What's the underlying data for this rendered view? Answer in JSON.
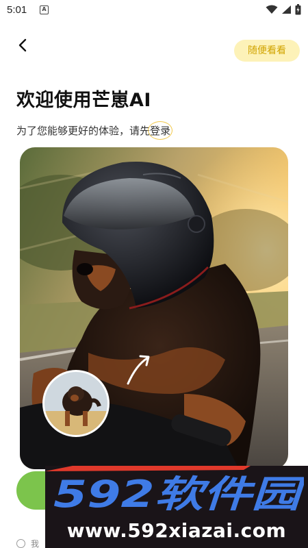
{
  "status_bar": {
    "time": "5:01",
    "notification_glyph": "A",
    "icons": [
      "wifi-icon",
      "signal-icon",
      "battery-icon"
    ]
  },
  "header": {
    "back_icon": "back-arrow-icon",
    "browse_label": "随便看看"
  },
  "welcome": {
    "title": "欢迎使用芒崽AI",
    "subtitle_prefix": "为了您能够更好的体验，请先",
    "login_label": "登录"
  },
  "hero": {
    "image": "dog-in-helmet-riding-motorcycle",
    "inset_image": "tibetan-mastiff-photo",
    "arrow_icon": "curved-arrow-icon"
  },
  "primary_button": {
    "color": "#7cc44c"
  },
  "agreement": {
    "text": "我"
  },
  "watermark": {
    "logo_text": "592软件园",
    "url": "www.592xiazai.com",
    "logo_color": "#3f7be6"
  },
  "colors": {
    "accent_yellow": "#fdf2b8",
    "accent_yellow_text": "#d1a400",
    "primary_green": "#7cc44c"
  }
}
